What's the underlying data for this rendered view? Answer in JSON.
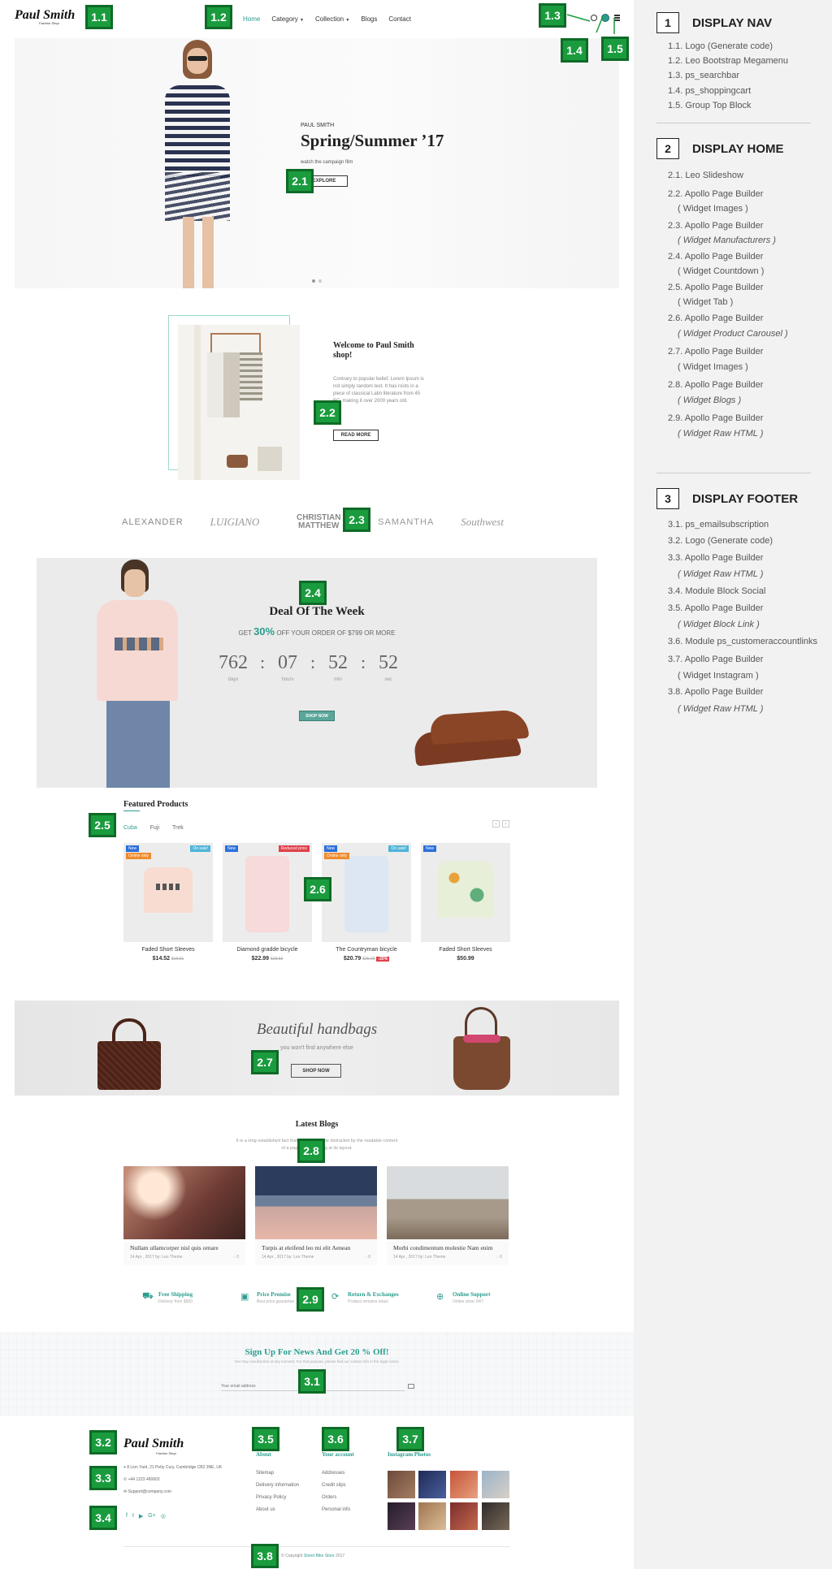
{
  "nav": {
    "logo_main": "Paul Smith",
    "logo_sub": "Fashion Shop",
    "menu": [
      "Home",
      "Category",
      "Collection",
      "Blogs",
      "Contact"
    ],
    "menu_has_caret": [
      false,
      true,
      true,
      false,
      false
    ],
    "icons": [
      "search-icon",
      "cart-icon",
      "menu-icon"
    ]
  },
  "hero": {
    "brand": "PAUL SMITH",
    "title": "Spring/Summer ’17",
    "subtitle": "watch the campaign film",
    "button": "EXPLORE"
  },
  "welcome": {
    "title": "Welcome to Paul Smith shop!",
    "text": "Contrary to popular belief, Lorem Ipsum is not simply random text. It has roots in a piece of classical Latin literature from 45 BC, making it over 2000 years old.",
    "button": "READ MORE"
  },
  "brands": [
    "ALEXANDER",
    "LUIGIANO",
    "CHRISTIAN MATTHEW",
    "SAMANTHA",
    "Southwest"
  ],
  "deal": {
    "title": "Deal Of The Week",
    "offer_pre": "GET",
    "offer_pct": "30%",
    "offer_post": "OFF YOUR ORDER OF $799 OR MORE",
    "countdown": [
      {
        "value": "762",
        "unit": "days"
      },
      {
        "value": "07",
        "unit": "hours"
      },
      {
        "value": "52",
        "unit": "min"
      },
      {
        "value": "52",
        "unit": "sec"
      }
    ],
    "button": "SHOP NOW"
  },
  "featured": {
    "title": "Featured Products",
    "tabs": [
      "Cuba",
      "Fuji",
      "Trek"
    ],
    "products": [
      {
        "name": "Faded Short Sleeves",
        "price": "$14.52",
        "old": "$16.51",
        "badges": [
          "New",
          "On sale!",
          "Online only"
        ]
      },
      {
        "name": "Diamond gradde bicycle",
        "price": "$22.99",
        "old": "$28.50",
        "badges": [
          "New",
          "Reduced price"
        ]
      },
      {
        "name": "The Countryman bicycle",
        "price": "$20.79",
        "old": "$25.99",
        "discount": "-20%",
        "badges": [
          "New",
          "On sale!",
          "Online only"
        ]
      },
      {
        "name": "Faded Short Sleeves",
        "price": "$50.99",
        "badges": [
          "New"
        ]
      }
    ]
  },
  "handbags": {
    "title": "Beautiful handbags",
    "subtitle": "you won't find anywhere else",
    "button": "SHOP NOW"
  },
  "blogs": {
    "title": "Latest Blogs",
    "intro": "It is a long established fact that a reader will be distracted by the readable content of a page when looking at its layout.",
    "posts": [
      {
        "title": "Nullam ullamcorper nisl quis ornare",
        "meta": "14 Apr , 2017 by: Leo Theme",
        "comments": "0"
      },
      {
        "title": "Turpis at eleifend leo mi elit Aenean",
        "meta": "14 Apr , 2017 by: Leo Theme",
        "comments": "0"
      },
      {
        "title": "Morbi condimentum molestie Nam enim",
        "meta": "14 Apr , 2017 by: Leo Theme",
        "comments": "0"
      }
    ]
  },
  "services": [
    {
      "icon": "truck-icon",
      "title": "Free Shipping",
      "desc": "Delivery from $500"
    },
    {
      "icon": "money-icon",
      "title": "Price Promise",
      "desc": "Best price guarantee"
    },
    {
      "icon": "refresh-icon",
      "title": "Return & Exchanges",
      "desc": "Product remains intact"
    },
    {
      "icon": "lifebuoy-icon",
      "title": "Online Support",
      "desc": "Online store 24/7"
    }
  ],
  "newsletter": {
    "title": "Sign Up For News And Get 20 % Off!",
    "desc": "You may unsubscribe at any moment. For that purpose, please find our contact info in the legal notice.",
    "placeholder": "Your email address"
  },
  "footer": {
    "logo": "Paul Smith",
    "logo_sub": "Fashion Shop",
    "address": "8 Lion Yard, 21 Petty Cury, Cambridge CB2 3NE, UK",
    "phone": "+44 1223 460602",
    "email": "Support@company.com",
    "social": [
      "facebook-icon",
      "twitter-icon",
      "youtube-icon",
      "google-plus-icon",
      "instagram-icon"
    ],
    "about_title": "About",
    "about_links": [
      "Sitemap",
      "Delivery information",
      "Privacy Policy",
      "About us"
    ],
    "account_title": "Your account",
    "account_links": [
      "Addresses",
      "Credit slips",
      "Orders",
      "Personal info"
    ],
    "insta_title": "Instagram Photos",
    "copyright_pre": "© Copyright",
    "copyright_brand": "Street Bike Store",
    "copyright_year": "2017"
  },
  "labels": {
    "l11": "1.1",
    "l12": "1.2",
    "l13": "1.3",
    "l14": "1.4",
    "l15": "1.5",
    "l21": "2.1",
    "l22": "2.2",
    "l23": "2.3",
    "l24": "2.4",
    "l25": "2.5",
    "l26": "2.6",
    "l27": "2.7",
    "l28": "2.8",
    "l29": "2.9",
    "l31": "3.1",
    "l32": "3.2",
    "l33": "3.3",
    "l34": "3.4",
    "l35": "3.5",
    "l36": "3.6",
    "l37": "3.7",
    "l38": "3.8"
  },
  "panel": {
    "sections": [
      {
        "num": "1",
        "title": "DISPLAY NAV",
        "items": [
          {
            "t": "1.1. Logo (Generate code)"
          },
          {
            "t": "1.2. Leo Bootstrap Megamenu"
          },
          {
            "t": "1.3. ps_searchbar"
          },
          {
            "t": "1.4. ps_shoppingcart"
          },
          {
            "t": "1.5. Group Top Block"
          }
        ]
      },
      {
        "num": "2",
        "title": "DISPLAY HOME",
        "items": [
          {
            "t": "2.1. Leo Slideshow"
          },
          {
            "t": "2.2. Apollo Page Builder",
            "s": "( Widget Images )"
          },
          {
            "t": "2.3.  Apollo Page Builder",
            "s": "( Widget Manufacturers )"
          },
          {
            "t": "2.4.  Apollo Page Builder",
            "s": "( Widget Countdown )"
          },
          {
            "t": "2.5.  Apollo Page Builder",
            "s": "( Widget Tab )"
          },
          {
            "t": "2.6. Apollo Page Builder",
            "s": "( Widget Product Carousel )"
          },
          {
            "t": "2.7. Apollo Page Builder",
            "s": "( Widget Images )"
          },
          {
            "t": "2.8. Apollo Page Builder",
            "s": "( Widget Blogs )"
          },
          {
            "t": "2.9. Apollo Page Builder",
            "s": "( Widget Raw HTML )"
          }
        ]
      },
      {
        "num": "3",
        "title": "DISPLAY FOOTER",
        "items": [
          {
            "t": "3.1. ps_emailsubscription"
          },
          {
            "t": "3.2. Logo (Generate code)"
          },
          {
            "t": "3.3. Apollo Page Builder",
            "s": "( Widget Raw HTML )"
          },
          {
            "t": "3.4. Module Block Social"
          },
          {
            "t": "3.5. Apollo Page Builder",
            "s": "( Widget Block Link )"
          },
          {
            "t": "3.6. Module ps_customeraccountlinks"
          },
          {
            "t": "3.7. Apollo Page Builder",
            "s": "( Widget Instagram )"
          },
          {
            "t": "3.8. Apollo Page Builder",
            "s": "( Widget Raw HTML )"
          }
        ]
      }
    ]
  }
}
